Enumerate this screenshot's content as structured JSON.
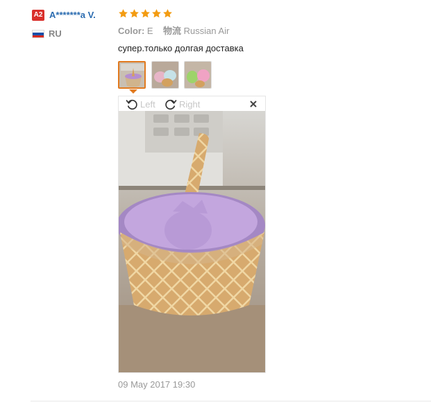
{
  "reviewer": {
    "level_badge": "A2",
    "name": "A*******a V.",
    "country": "RU",
    "flag_colors": [
      "#ffffff",
      "#1a4fa8",
      "#d52b1e"
    ]
  },
  "rating": {
    "stars": 5,
    "max": 5,
    "color": "#f39c12"
  },
  "properties": {
    "color_label": "Color:",
    "color_value": "E",
    "shipping_label": "物流",
    "shipping_value": "Russian Air"
  },
  "review_text": "супер.только долгая доставка",
  "photos": {
    "thumbnail_names": [
      "photo-1",
      "photo-2",
      "photo-3"
    ],
    "active_index": 0,
    "viewer": {
      "rotate_left_label": "Left",
      "rotate_right_label": "Right",
      "close_icon": "close-icon"
    }
  },
  "date": "09 May 2017 19:30",
  "colors": {
    "accent": "#e17a1f",
    "link": "#2b6cb0",
    "badge": "#d9302c"
  }
}
